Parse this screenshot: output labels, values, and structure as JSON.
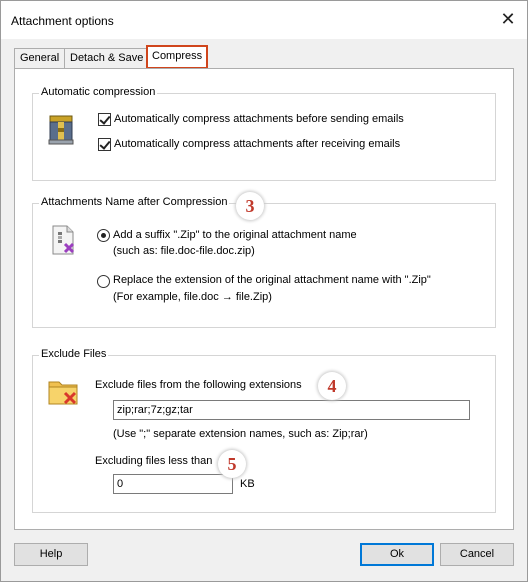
{
  "window": {
    "title": "Attachment options",
    "close_glyph": "✕"
  },
  "tabs": [
    {
      "label": "General"
    },
    {
      "label": "Detach & Save"
    },
    {
      "label": "Compress",
      "active": true
    }
  ],
  "auto_compression": {
    "label": "Automatic compression",
    "icon": "archive-icon",
    "options": [
      {
        "label": "Automatically compress attachments before sending emails",
        "checked": true
      },
      {
        "label": "Automatically compress attachments after receiving emails",
        "checked": true
      }
    ]
  },
  "name_after_compression": {
    "label": "Attachments Name after Compression",
    "marker": "3",
    "icon": "zip-document-icon",
    "options": [
      {
        "label": "Add a suffix \".Zip\" to the original attachment name",
        "example": "(such as: file.doc-file.doc.zip)",
        "selected": true
      },
      {
        "label": "Replace the extension of the original attachment name with \".Zip\"",
        "example": "(For example, file.doc → file.Zip)",
        "selected": false
      }
    ]
  },
  "exclude_files": {
    "label": "Exclude Files",
    "icon": "folder-exclude-icon",
    "extensions_label": "Exclude files from the following extensions",
    "marker_extensions": "4",
    "extensions_value": "zip;rar;7z;gz;tar",
    "extensions_hint": "(Use \";\" separate extension names, such as: Zip;rar)",
    "size_label": "Excluding files less than",
    "marker_size": "5",
    "size_value": "0",
    "size_unit": "KB"
  },
  "footer": {
    "help": "Help",
    "ok": "Ok",
    "cancel": "Cancel"
  },
  "colors": {
    "active_tab_border": "#d0451c",
    "marker_text": "#c0392b",
    "default_button_border": "#0078d7"
  }
}
